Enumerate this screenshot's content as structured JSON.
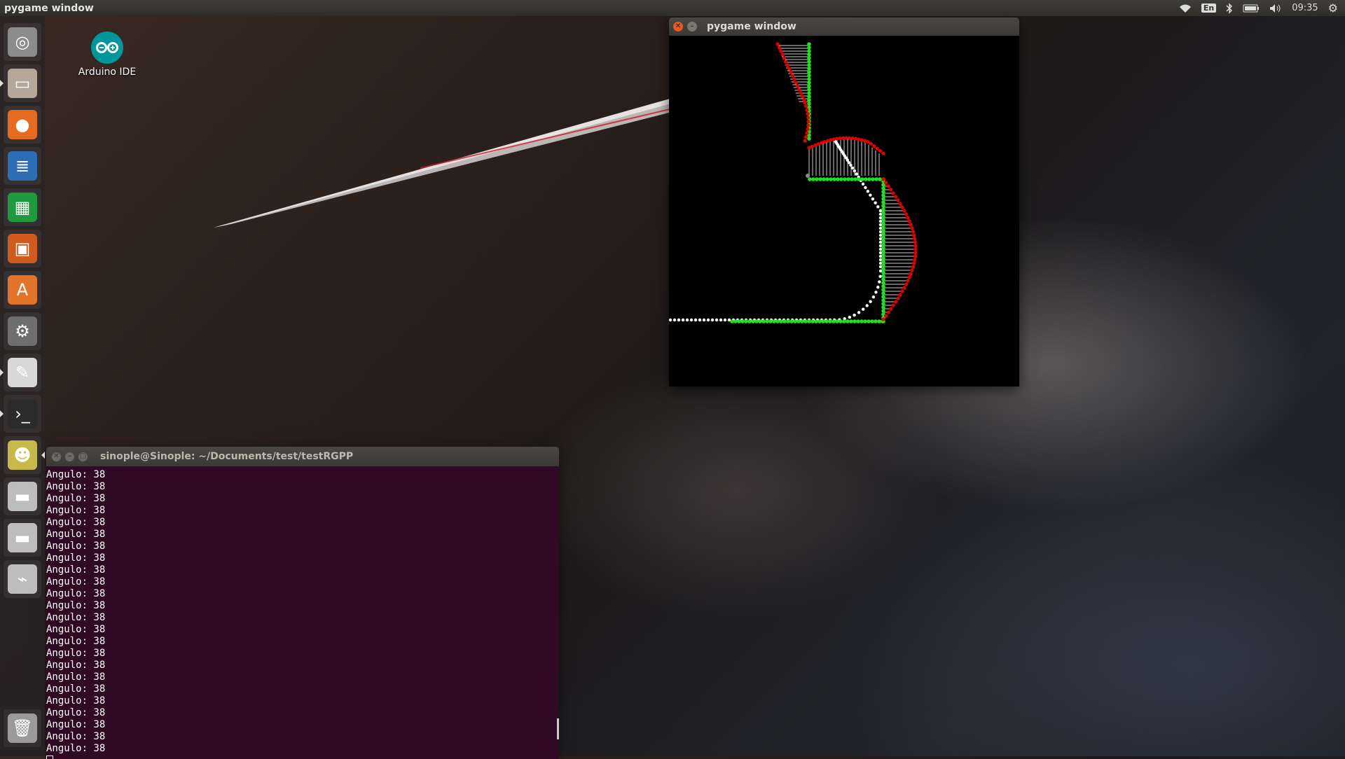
{
  "top_panel": {
    "app_title": "pygame window",
    "keyboard_layout": "En",
    "clock": "09:35",
    "icons": [
      "wifi-icon",
      "keyboard-layout-indicator",
      "bluetooth-icon",
      "battery-icon",
      "volume-icon",
      "settings-gear-icon"
    ]
  },
  "launcher": {
    "items": [
      {
        "name": "ubuntu-dash",
        "glyph": "◎",
        "color": "#8c8c8c"
      },
      {
        "name": "files",
        "glyph": "▭",
        "color": "#b6a79a"
      },
      {
        "name": "firefox",
        "glyph": "●",
        "color": "#e66a1f"
      },
      {
        "name": "libreoffice-writer",
        "glyph": "≣",
        "color": "#2d6db5"
      },
      {
        "name": "libreoffice-calc",
        "glyph": "▦",
        "color": "#1f9a3f"
      },
      {
        "name": "libreoffice-impress",
        "glyph": "▣",
        "color": "#d15a1f"
      },
      {
        "name": "software-center",
        "glyph": "A",
        "color": "#e2732a"
      },
      {
        "name": "system-settings",
        "glyph": "⚙",
        "color": "#6e6e6e"
      },
      {
        "name": "text-editor",
        "glyph": "✎",
        "color": "#d8d8d8"
      },
      {
        "name": "terminal",
        "glyph": "›_",
        "color": "#2b2b2b"
      },
      {
        "name": "python-app",
        "glyph": "☻",
        "color": "#c7b84a"
      },
      {
        "name": "drive-1",
        "glyph": "▬",
        "color": "#bdbdbd"
      },
      {
        "name": "drive-2",
        "glyph": "▬",
        "color": "#bdbdbd"
      },
      {
        "name": "usb-drive",
        "glyph": "⌁",
        "color": "#bdbdbd"
      }
    ],
    "trash": {
      "name": "trash",
      "glyph": "🗑",
      "color": "#9a9a9a"
    }
  },
  "desktop": {
    "icons": [
      {
        "label": "Arduino IDE"
      }
    ]
  },
  "pygame_window": {
    "title": "pygame window",
    "colors": {
      "background": "#000000",
      "red": "#e00000",
      "green": "#22dd22",
      "white": "#ffffff",
      "hatch": "#cccccc"
    }
  },
  "terminal": {
    "title": "sinople@Sinople: ~/Documents/test/testRGPP",
    "lines": [
      "Angulo: 38",
      "Angulo: 38",
      "Angulo: 38",
      "Angulo: 38",
      "Angulo: 38",
      "Angulo: 38",
      "Angulo: 38",
      "Angulo: 38",
      "Angulo: 38",
      "Angulo: 38",
      "Angulo: 38",
      "Angulo: 38",
      "Angulo: 38",
      "Angulo: 38",
      "Angulo: 38",
      "Angulo: 38",
      "Angulo: 38",
      "Angulo: 38",
      "Angulo: 38",
      "Angulo: 38",
      "Angulo: 38",
      "Angulo: 38",
      "Angulo: 38",
      "Angulo: 38"
    ]
  }
}
